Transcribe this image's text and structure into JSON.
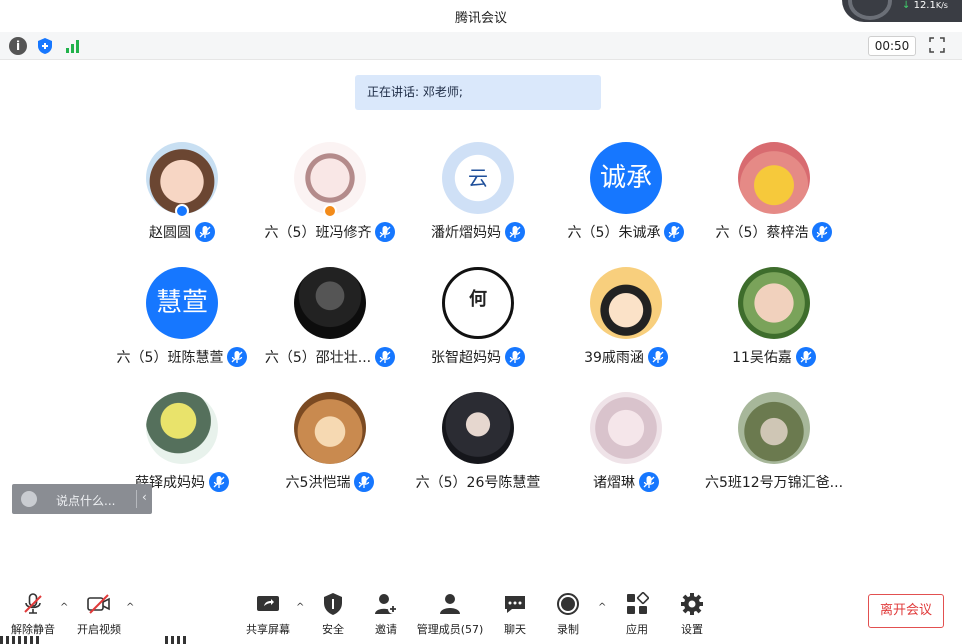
{
  "window": {
    "title": "腾讯会议",
    "net_speed": "12.1",
    "net_unit": "K/s"
  },
  "infobar": {
    "timer": "00:50"
  },
  "speaking": {
    "text": "正在讲话: 邓老师;"
  },
  "participants": [
    {
      "name": "赵圆圆",
      "avatar_text": "",
      "badge": "host-blue"
    },
    {
      "name": "六（5）班冯修齐",
      "avatar_text": "",
      "badge": "host-orange"
    },
    {
      "name": "潘炘熠妈妈",
      "avatar_text": "云",
      "badge": ""
    },
    {
      "name": "六（5）朱诚承",
      "avatar_text": "诚承",
      "badge": ""
    },
    {
      "name": "六（5）蔡梓浩",
      "avatar_text": "",
      "badge": ""
    },
    {
      "name": "六（5）班陈慧萱",
      "avatar_text": "慧萱",
      "badge": ""
    },
    {
      "name": "六（5）邵壮壮...",
      "avatar_text": "",
      "badge": ""
    },
    {
      "name": "张智超妈妈",
      "avatar_text": "何",
      "badge": ""
    },
    {
      "name": "39戚雨涵",
      "avatar_text": "",
      "badge": ""
    },
    {
      "name": "11吴佑嘉",
      "avatar_text": "",
      "badge": ""
    },
    {
      "name": "薛铎成妈妈",
      "avatar_text": "",
      "badge": ""
    },
    {
      "name": "六5洪恺瑞",
      "avatar_text": "",
      "badge": ""
    },
    {
      "name": "六（5）26号陈慧萱",
      "avatar_text": "",
      "badge": ""
    },
    {
      "name": "诸熠琳",
      "avatar_text": "",
      "badge": ""
    },
    {
      "name": "六5班12号万锦汇爸...",
      "avatar_text": "",
      "badge": ""
    }
  ],
  "chat": {
    "placeholder": "说点什么..."
  },
  "toolbar": {
    "unmute": "解除静音",
    "start_video": "开启视频",
    "share_screen": "共享屏幕",
    "security": "安全",
    "invite": "邀请",
    "manage_members": "管理成员(57)",
    "chat": "聊天",
    "record": "录制",
    "apps": "应用",
    "settings": "设置",
    "leave": "离开会议"
  },
  "colors": {
    "accent": "#1677ff",
    "leave_red": "#e03a3a",
    "speaking_bg": "#dae8fb"
  }
}
